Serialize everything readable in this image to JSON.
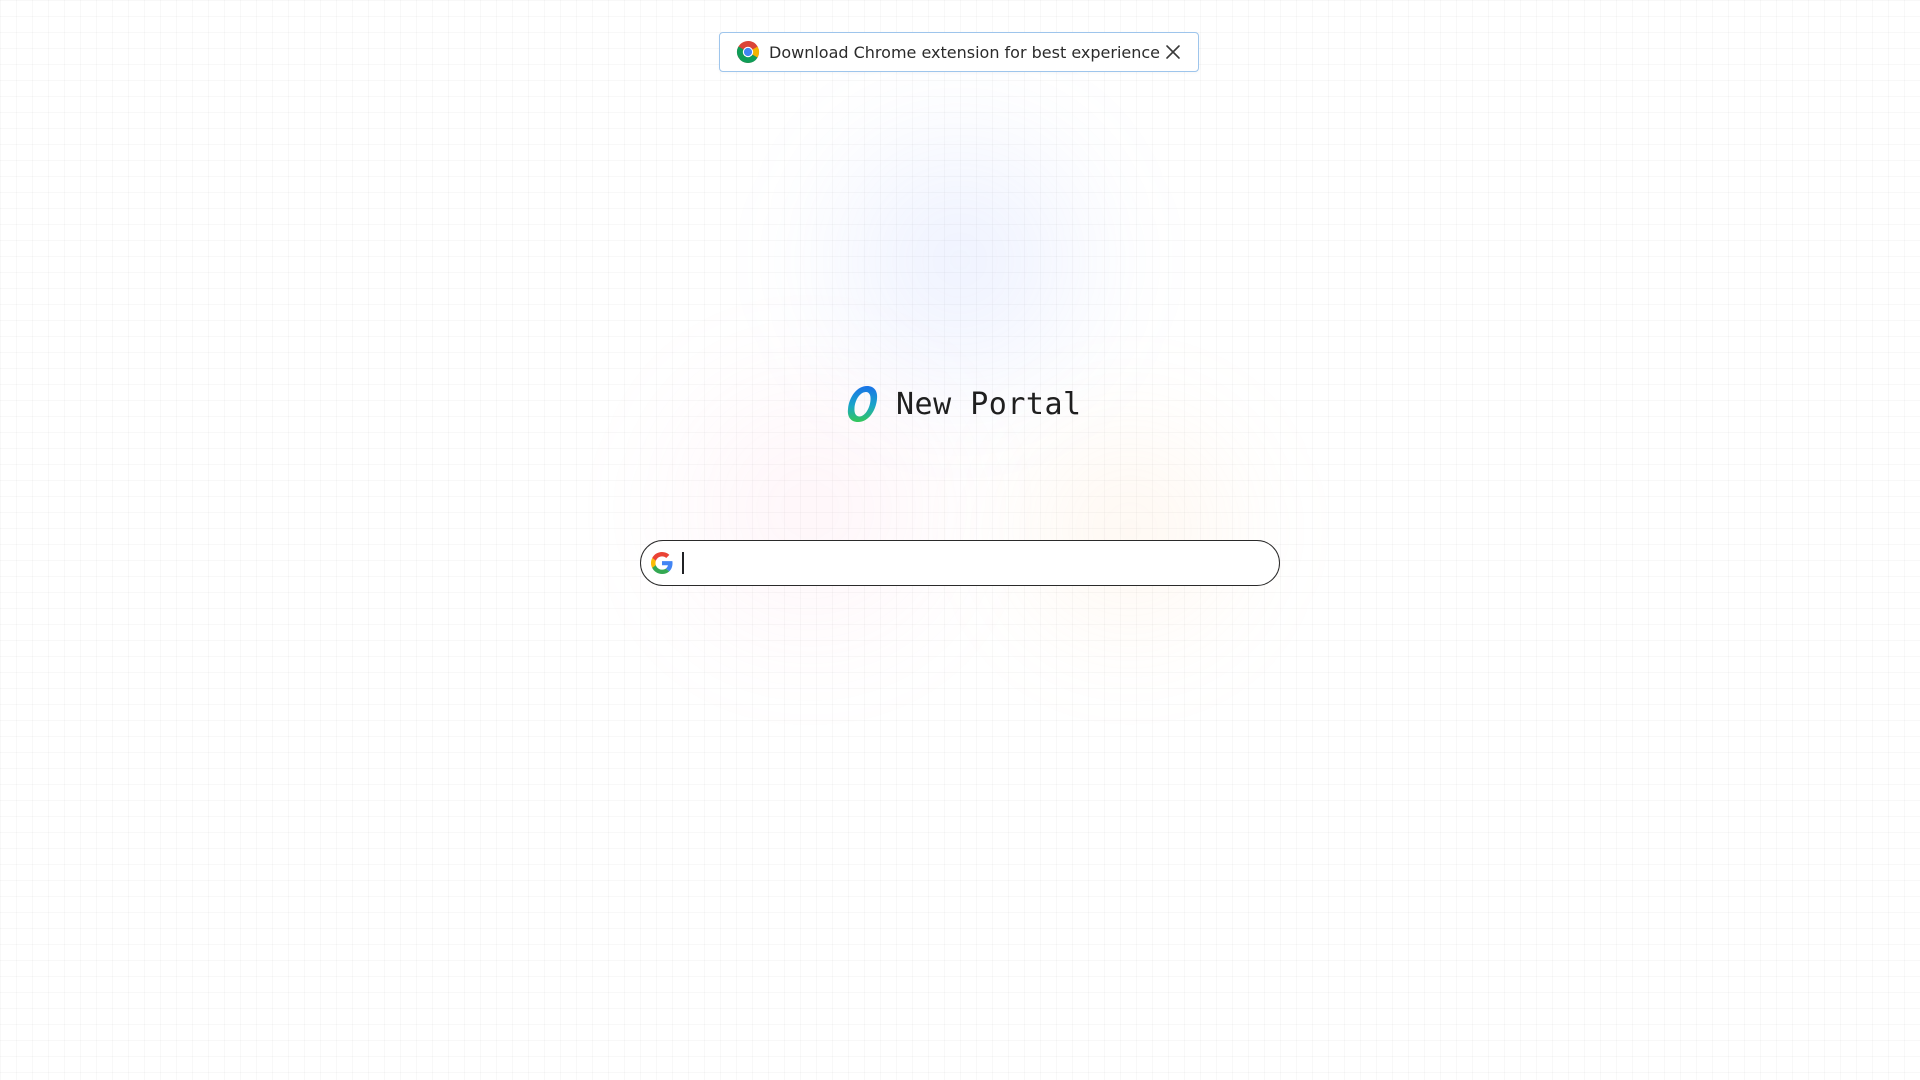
{
  "banner": {
    "text": "Download Chrome extension for best experience",
    "icon": "chrome-icon",
    "close_icon": "close-icon",
    "border_color": "#9ec5ec"
  },
  "brand": {
    "name": "New Portal",
    "logo_icon": "portal-logo-icon",
    "logo_colors": [
      "#1a73e8",
      "#34c759"
    ]
  },
  "search": {
    "value": "",
    "placeholder": "",
    "icon": "google-icon"
  }
}
